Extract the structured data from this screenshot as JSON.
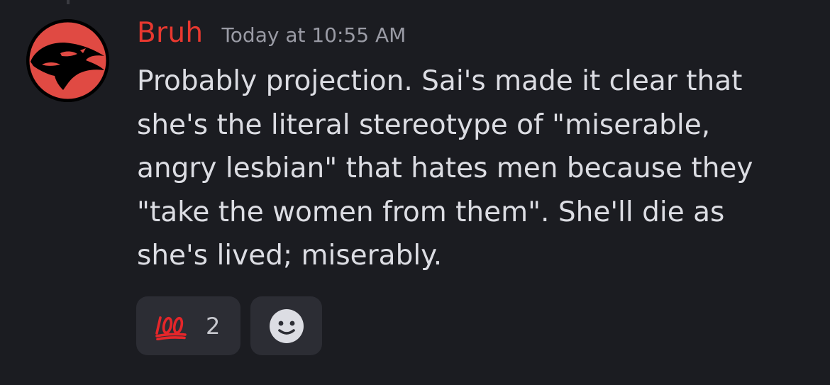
{
  "message": {
    "author": "Bruh",
    "timestamp": "Today at 10:55 AM",
    "lines": [
      "Probably projection. Sai's made it clear that",
      "she's the literal stereotype of \"miserable,",
      "angry lesbian\" that hates men because they",
      "\"take the women from them\". She'll die as",
      "she's lived; miserably."
    ],
    "avatar_icon": "thundercats-logo-icon"
  },
  "reactions": [
    {
      "icon": "hundred-points-emoji",
      "count": "2"
    },
    {
      "icon": "add-reaction-smiley-icon"
    }
  ],
  "colors": {
    "background": "#1b1c21",
    "username": "#e8382f",
    "text": "#dcdde3",
    "timestamp": "#9a9ba5",
    "reaction_bg": "#2c2d34"
  }
}
